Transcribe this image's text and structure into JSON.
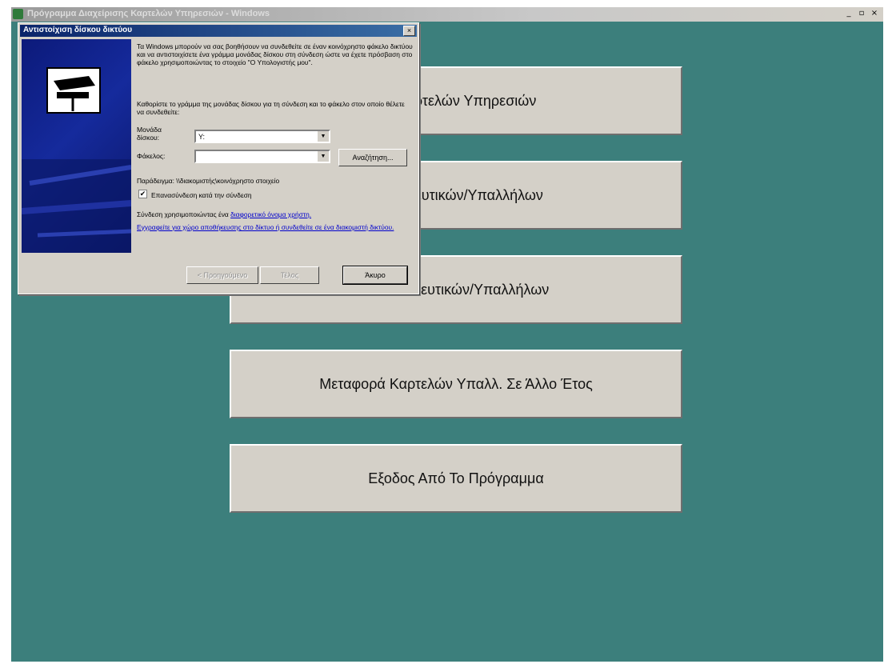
{
  "window": {
    "title": "Πρόγραμμα Διαχείρισης Καρτελών Υπηρεσιών - Windows",
    "controls": [
      "_",
      "▫",
      "×"
    ]
  },
  "menu": {
    "buttons": [
      "ση Καρτελών Υπηρεσιών",
      "Εκπαιδευτικών/Υπαλλήλων",
      "υ Εκπαιδευτικών/Υπαλλήλων",
      "Μεταφορά Καρτελών Υπαλλ. Σε Άλλο Έτος",
      "Εξοδος Από Το Πρόγραμμα"
    ]
  },
  "dialog": {
    "title": "Αντιστοίχιση δίσκου δικτύου",
    "close": "×",
    "intro": "Τα Windows μπορούν να σας βοηθήσουν να συνδεθείτε σε έναν κοινόχρηστο φάκελο δικτύου και να αντιστοιχίσετε ένα γράμμα μονάδας δίσκου στη σύνδεση ώστε να έχετε πρόσβαση στο φάκελο χρησιμοποιώντας το στοιχείο \"Ο Υπολογιστής μου\".",
    "instruction": "Καθορίστε το γράμμα της μονάδας δίσκου για τη σύνδεση και το φάκελο στον οποίο θέλετε να συνδεθείτε:",
    "drive_label": "Μονάδα δίσκου:",
    "drive_value": "Y:",
    "folder_label": "Φάκελος:",
    "folder_value": "",
    "browse_button": "Αναζήτηση...",
    "example": "Παράδειγμα: \\\\διακομιστής\\κοινόχρηστο στοιχείο",
    "reconnect_label": "Επανασύνδεση κατά την σύνδεση",
    "reconnect_checked": "✔",
    "connect_as_prefix": "Σύνδεση χρησιμοποιώντας ένα ",
    "connect_as_link": "διαφορετικό όνομα χρήστη.",
    "storage_link": "Εγγραφείτε για χώρο αποθήκευσης στο δίκτυο ή συνδεθείτε σε ένα διακομιστή δικτύου.",
    "back_button": "< Προηγούμενο",
    "finish_button": "Τέλος",
    "cancel_button": "Άκυρο"
  }
}
